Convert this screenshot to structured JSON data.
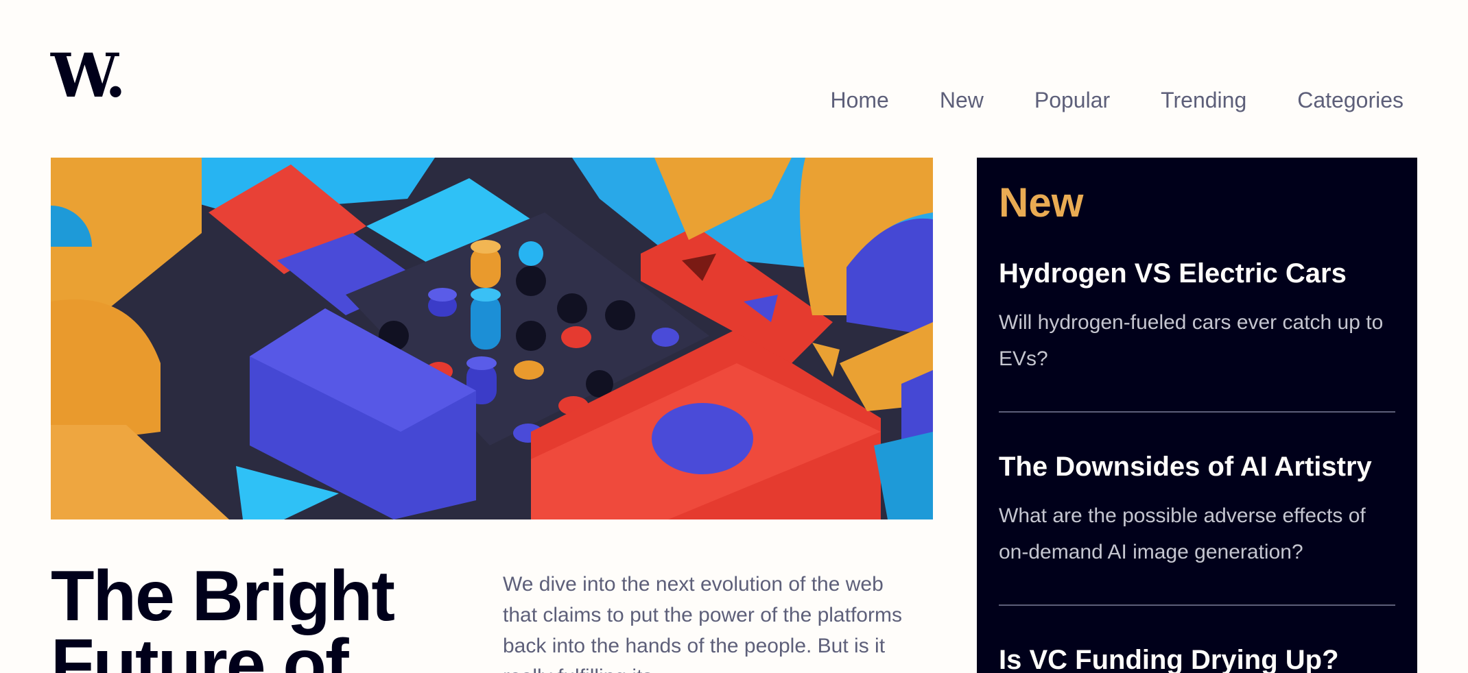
{
  "brand": {
    "logo": "W."
  },
  "nav": {
    "items": [
      {
        "label": "Home"
      },
      {
        "label": "New"
      },
      {
        "label": "Popular"
      },
      {
        "label": "Trending"
      },
      {
        "label": "Categories"
      }
    ]
  },
  "hero": {
    "image_icon": "abstract-3d-blocks-image"
  },
  "article": {
    "headline_line1": "The Bright",
    "headline_line2": "Future of",
    "lede": "We dive into the next evolution of the web that claims to put the power of the platforms back into the hands of the people. But is it really fulfilling its"
  },
  "sidebar": {
    "title": "New",
    "items": [
      {
        "title": "Hydrogen VS Electric Cars",
        "text": "Will hydrogen-fueled cars ever catch up to EVs?"
      },
      {
        "title": "The Downsides of AI Artistry",
        "text": "What are the possible adverse effects of on-demand AI image generation?"
      },
      {
        "title": "Is VC Funding Drying Up?"
      }
    ]
  },
  "colors": {
    "dark": "#00001a",
    "accent": "#e9ab53",
    "muted": "#5d5f79",
    "background": "#fffdfa"
  }
}
